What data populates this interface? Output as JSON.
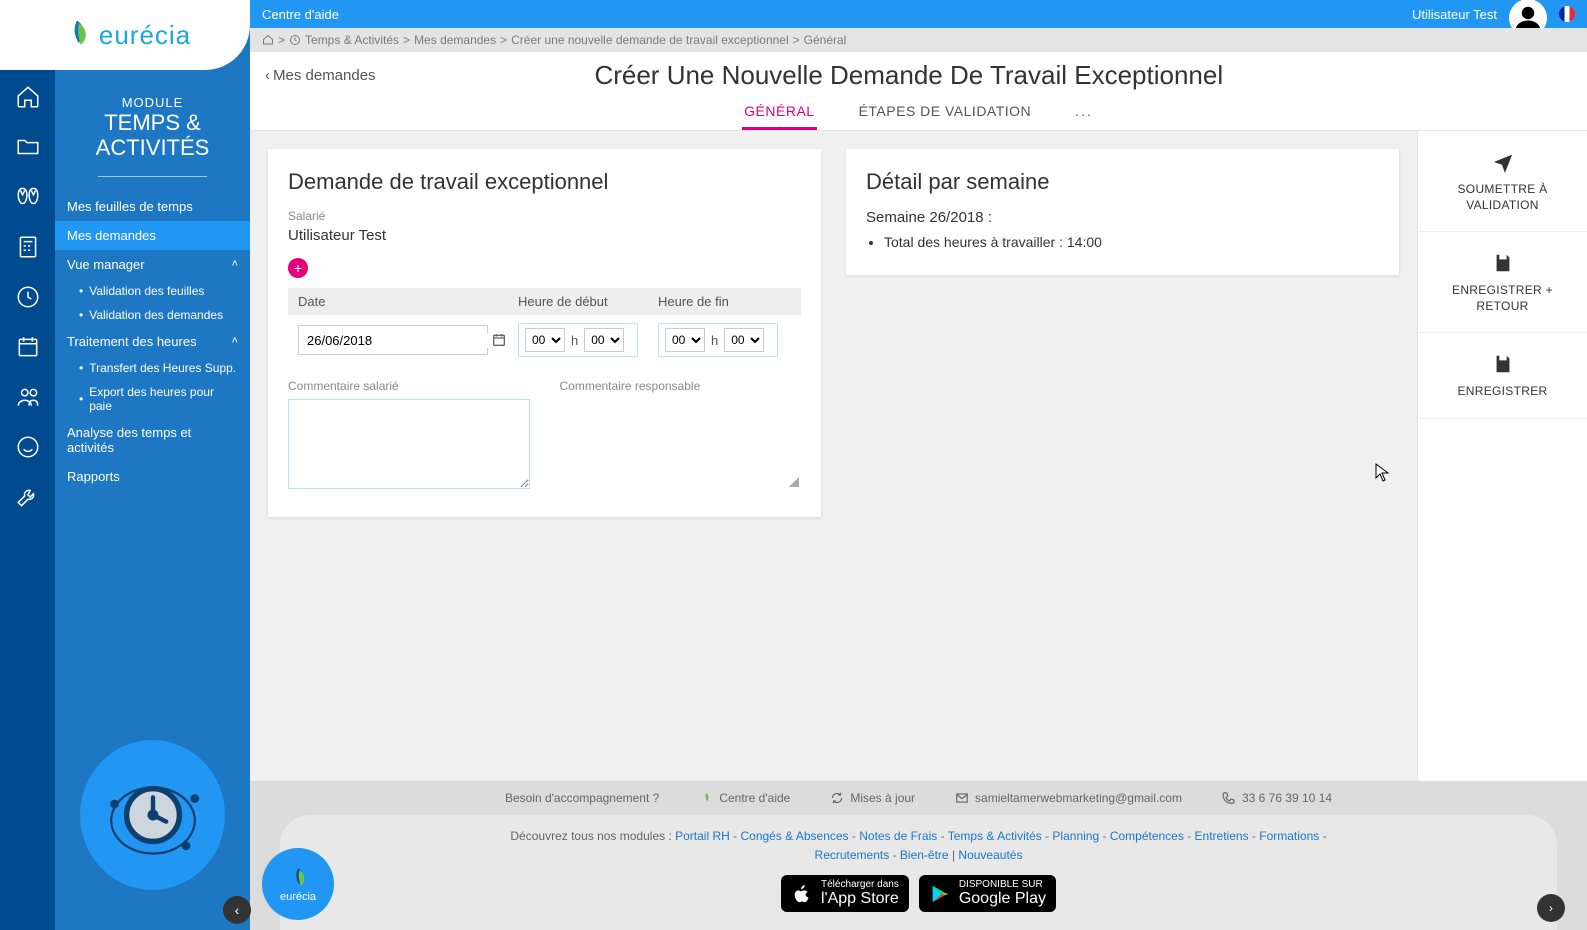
{
  "brand": "eurécia",
  "topbar": {
    "help": "Centre d'aide",
    "user": "Utilisateur  Test"
  },
  "breadcrumb": {
    "items": [
      "Temps & Activités",
      "Mes demandes",
      "Créer une nouvelle demande de travail exceptionnel",
      "Général"
    ],
    "sep": ">"
  },
  "module": {
    "label": "MODULE",
    "title": "TEMPS & ACTIVITÉS"
  },
  "nav": {
    "feuilles": "Mes feuilles de temps",
    "demandes": "Mes demandes",
    "manager": "Vue manager",
    "valid_feuilles": "Validation des feuilles",
    "valid_demandes": "Validation des demandes",
    "traitement": "Traitement des heures",
    "transfert": "Transfert des Heures Supp.",
    "export": "Export des heures pour paie",
    "analyse": "Analyse des temps et activités",
    "rapports": "Rapports"
  },
  "page": {
    "back": "Mes demandes",
    "title": "Créer Une Nouvelle Demande De Travail Exceptionnel",
    "tabs": {
      "general": "GÉNÉRAL",
      "etapes": "ÉTAPES DE VALIDATION",
      "more": "..."
    }
  },
  "form": {
    "card_title": "Demande de travail exceptionnel",
    "salarie_label": "Salarié",
    "salarie_value": "Utilisateur Test",
    "headers": {
      "date": "Date",
      "start": "Heure de début",
      "end": "Heure de fin"
    },
    "date_value": "26/06/2018",
    "time_h_sep": "h",
    "start_h": "00",
    "start_m": "00",
    "end_h": "00",
    "end_m": "00",
    "comment_salarie_label": "Commentaire salarié",
    "comment_resp_label": "Commentaire responsable",
    "comment_salarie_value": ""
  },
  "detail": {
    "title": "Détail par semaine",
    "week": "Semaine 26/2018 :",
    "bullet": "Total des heures à travailler : 14:00"
  },
  "actions": {
    "submit": "SOUMETTRE À VALIDATION",
    "save_back": "ENREGISTRER + RETOUR",
    "save": "ENREGISTRER"
  },
  "footer": {
    "accomp": "Besoin d'accompagnement ?",
    "aide": "Centre d'aide",
    "maj": "Mises à jour",
    "email": "samieltamerwebmarketing@gmail.com",
    "phone": "33 6 76 39 10 14",
    "discover": "Découvrez tous nos modules : ",
    "modules": [
      "Portail RH",
      "Congés & Absences",
      "Notes de Frais",
      "Temps & Activités",
      "Planning",
      "Compétences",
      "Entretiens",
      "Formations",
      "Recrutements",
      "Bien-être"
    ],
    "sep": " - ",
    "news_sep": "   |   ",
    "news": "Nouveautés",
    "appstore_small": "Télécharger dans",
    "appstore_big": "l'App Store",
    "play_small": "DISPONIBLE SUR",
    "play_big": "Google Play"
  }
}
